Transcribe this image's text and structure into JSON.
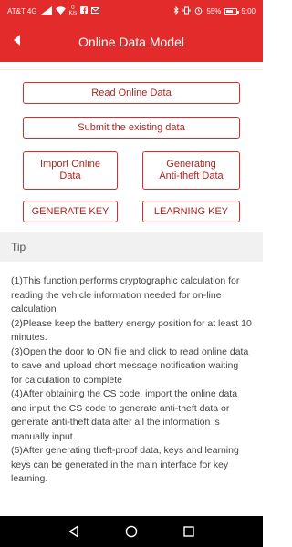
{
  "status_bar": {
    "carrier": "AT&T 4G",
    "speed_value": "0",
    "speed_unit": "K/s",
    "battery_percent": "55%",
    "battery_level": 0.55,
    "time": "5:00"
  },
  "header": {
    "title": "Online Data Model",
    "background_color": "#e42b2b"
  },
  "buttons": {
    "read_online": "Read Online Data",
    "submit_existing": "Submit the existing data",
    "import_online_line1": "Import Online",
    "import_online_line2": "Data",
    "anti_theft_line1": "Generating",
    "anti_theft_line2": "Anti-theft Data",
    "generate_key": "GENERATE KEY",
    "learning_key": "LEARNING KEY",
    "border_color": "#cf2f2f"
  },
  "tip": {
    "title": "Tip",
    "lines": [
      "(1)This function performs cryptographic calculation for reading the vehicle information needed for on-line calculation",
      "(2)Please keep the battery energy position for at least 10 minutes.",
      "(3)Open the door to ON file and click to read online data to save and upload short message notification waiting for calculation to complete",
      "(4)After obtaining the CS code, import the online data and input the CS code to generate anti-theft data or generate anti-theft data after all the information is manually input.",
      "(5)After generating theft-proof data, keys and learning keys can be generated in the main interface for key learning."
    ]
  },
  "nav_bar": {
    "icons": [
      "back-triangle-icon",
      "home-circle-icon",
      "recents-square-icon"
    ]
  }
}
